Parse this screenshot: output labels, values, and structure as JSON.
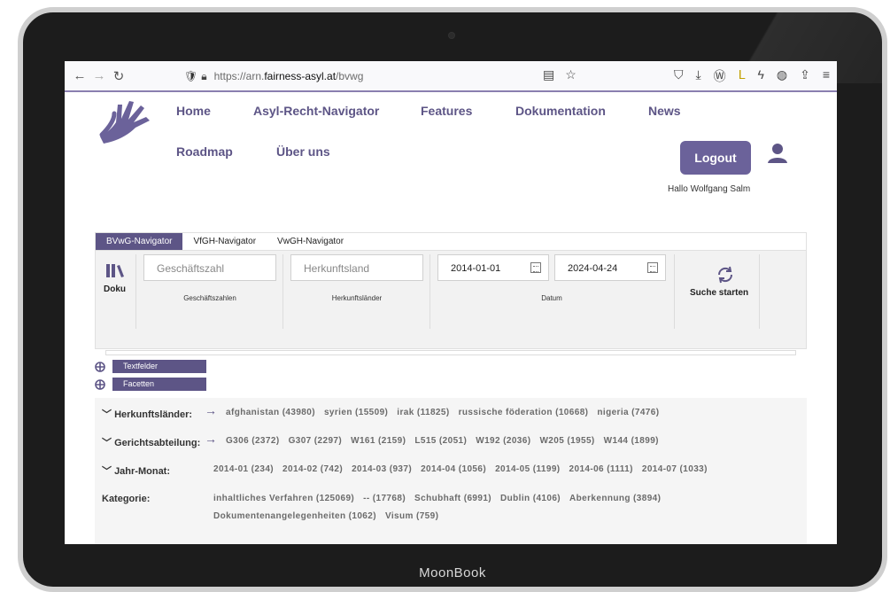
{
  "device": {
    "brand": "MoonBook"
  },
  "browser": {
    "url_prefix": "https://arn.",
    "url_host": "fairness-asyl.at",
    "url_path": "/bvwg"
  },
  "nav": {
    "home": "Home",
    "navigator": "Asyl-Recht-Navigator",
    "features": "Features",
    "docs": "Dokumentation",
    "news": "News",
    "roadmap": "Roadmap",
    "about": "Über uns"
  },
  "user": {
    "logout": "Logout",
    "greeting": "Hallo Wolfgang Salm"
  },
  "tabs": [
    "BVwG-Navigator",
    "VfGH-Navigator",
    "VwGH-Navigator"
  ],
  "panel": {
    "doku": "Doku",
    "gz_placeholder": "Geschäftszahl",
    "gz_caption": "Geschäftszahlen",
    "land_placeholder": "Herkunftsland",
    "land_caption": "Herkunftsländer",
    "date_from": "2014-01-01",
    "date_to": "2024-04-24",
    "date_caption": "Datum",
    "search": "Suche starten"
  },
  "accordion": {
    "textfelder": "Textfelder",
    "facetten": "Facetten"
  },
  "facets": {
    "herkunft": {
      "label": "Herkunftsländer:",
      "values": [
        "afghanistan (43980)",
        "syrien (15509)",
        "irak (11825)",
        "russische föderation (10668)",
        "nigeria (7476)"
      ]
    },
    "gericht": {
      "label": "Gerichtsabteilung:",
      "values": [
        "G306 (2372)",
        "G307 (2297)",
        "W161 (2159)",
        "L515 (2051)",
        "W192 (2036)",
        "W205 (1955)",
        "W144 (1899)"
      ]
    },
    "jahr": {
      "label": "Jahr-Monat:",
      "values": [
        "2014-01 (234)",
        "2014-02 (742)",
        "2014-03 (937)",
        "2014-04 (1056)",
        "2014-05 (1199)",
        "2014-06 (1111)",
        "2014-07 (1033)"
      ]
    },
    "kategorie": {
      "label": "Kategorie:",
      "values_line1": [
        "inhaltliches Verfahren (125069)",
        "-- (17768)",
        "Schubhaft (6991)",
        "Dublin (4106)",
        "Aberkennung (3894)"
      ],
      "values_line2": [
        "Dokumentenangelegenheiten (1062)",
        "Visum (759)"
      ]
    }
  }
}
